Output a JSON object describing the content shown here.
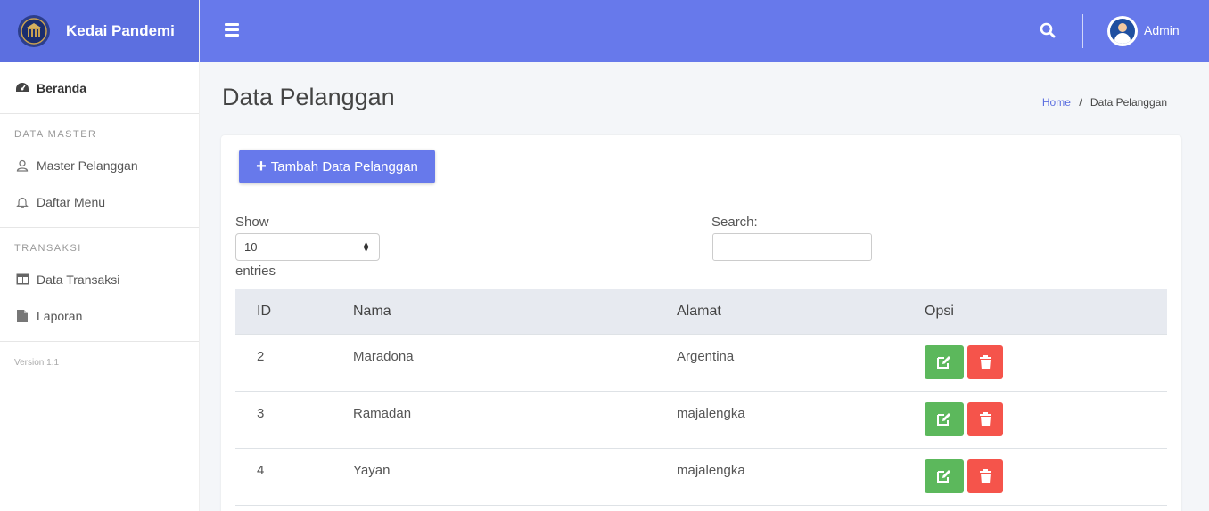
{
  "sidebar": {
    "brand": "Kedai Pandemi",
    "home": "Beranda",
    "section_master": "DATA MASTER",
    "master_items": [
      "Master Pelanggan",
      "Daftar Menu"
    ],
    "section_transaksi": "TRANSAKSI",
    "transaksi_items": [
      "Data Transaksi",
      "Laporan"
    ],
    "version": "Version 1.1"
  },
  "topbar": {
    "user": "Admin"
  },
  "page": {
    "title": "Data Pelanggan",
    "breadcrumb_home": "Home",
    "breadcrumb_sep": "/",
    "breadcrumb_current": "Data Pelanggan",
    "add_button": "Tambah Data Pelanggan",
    "show_label": "Show",
    "entries_value": "10",
    "entries_label": "entries",
    "search_label": "Search:",
    "search_value": ""
  },
  "table": {
    "headers": [
      "ID",
      "Nama",
      "Alamat",
      "Opsi"
    ],
    "rows": [
      {
        "id": "2",
        "nama": "Maradona",
        "alamat": "Argentina"
      },
      {
        "id": "3",
        "nama": "Ramadan",
        "alamat": "majalengka"
      },
      {
        "id": "4",
        "nama": "Yayan",
        "alamat": "majalengka"
      }
    ]
  },
  "colors": {
    "primary": "#6779eb",
    "brand": "#5c6fe0",
    "edit": "#5cb85c",
    "delete": "#f5544b"
  }
}
